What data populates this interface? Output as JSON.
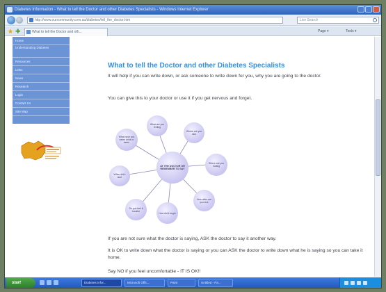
{
  "browser": {
    "title": "Diabetes Information - What to tell the Doctor and other Diabetes Specialists - Windows Internet Explorer",
    "url": "http://www.ourcommunity.com.au/diabetes/tell_the_doctor.htm",
    "search_placeholder": "Live Search",
    "tab_label": "What to tell the Doctor and oth...",
    "commands": [
      "Page ▾",
      "Tools ▾"
    ]
  },
  "sidebar": {
    "items": [
      "Home",
      "Understanding Diabetes",
      "Resources",
      "Links",
      "News",
      "Research",
      "Login",
      "Contact Us",
      "Site Map"
    ]
  },
  "page": {
    "heading": "What to tell the Doctor and other Diabetes Specialists",
    "p1": "It will help if you can write down, or ask someone to write down for you, why you are going to the doctor.",
    "p2": "You can give this to your doctor or use it if you get nervous and forget.",
    "p3": "If you are not sure what the doctor is saying, ASK the doctor to say it another way.",
    "p4": "It is OK to write down what the doctor is saying or you can ASK the doctor to write down what he is saying so you can take it home.",
    "p5": "Say NO if you feel uncomfortable - IT IS OK!!"
  },
  "mindmap": {
    "center": "AT THE DOCTOR OR REMEMBER TO SAY",
    "nodes": [
      "What are you feeling",
      "Where are you sick",
      "Where are you hurting",
      "How often are you sick",
      "How did it begin",
      "Do you feel it breathe",
      "When did it start",
      "What have you eaten drink or taken"
    ]
  },
  "taskbar": {
    "start": "start",
    "tasks": [
      "Diabetes Infor...",
      "Microsoft Offic...",
      "Paint",
      "Untitled - Pa..."
    ]
  },
  "colors": {
    "accent": "#3a8fd8",
    "sidebar": "#6b94d6",
    "bubble": "#c9c6f0"
  }
}
